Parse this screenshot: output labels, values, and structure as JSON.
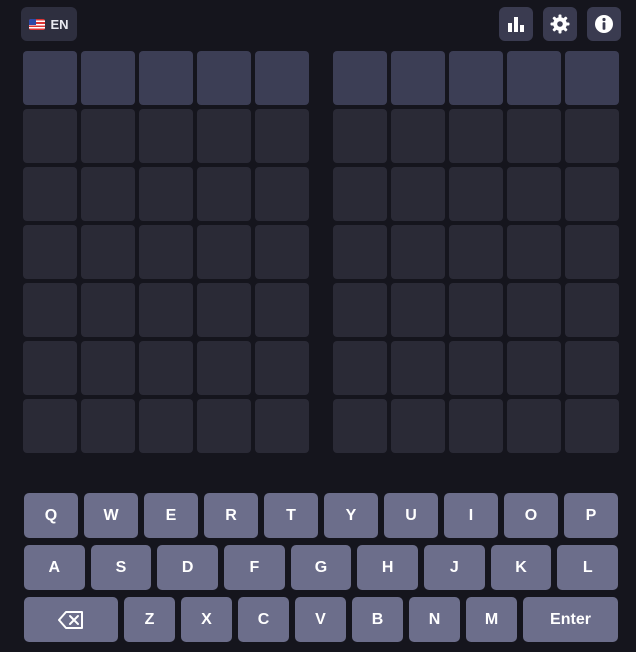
{
  "header": {
    "language_label": "EN",
    "icons": [
      "flag-us-icon",
      "bar-chart-icon",
      "gear-icon",
      "info-icon"
    ]
  },
  "boards": {
    "count": 2,
    "rows": 7,
    "cols": 5,
    "active_row": 0
  },
  "keyboard": {
    "row1": [
      "Q",
      "W",
      "E",
      "R",
      "T",
      "Y",
      "U",
      "I",
      "O",
      "P"
    ],
    "row2": [
      "A",
      "S",
      "D",
      "F",
      "G",
      "H",
      "J",
      "K",
      "L"
    ],
    "row3": [
      "Z",
      "X",
      "C",
      "V",
      "B",
      "N",
      "M"
    ],
    "enter_label": "Enter"
  },
  "colors": {
    "background": "#15151d",
    "tile": "#2a2a36",
    "tile_active": "#3c3e55",
    "key": "#6c6e8b"
  }
}
